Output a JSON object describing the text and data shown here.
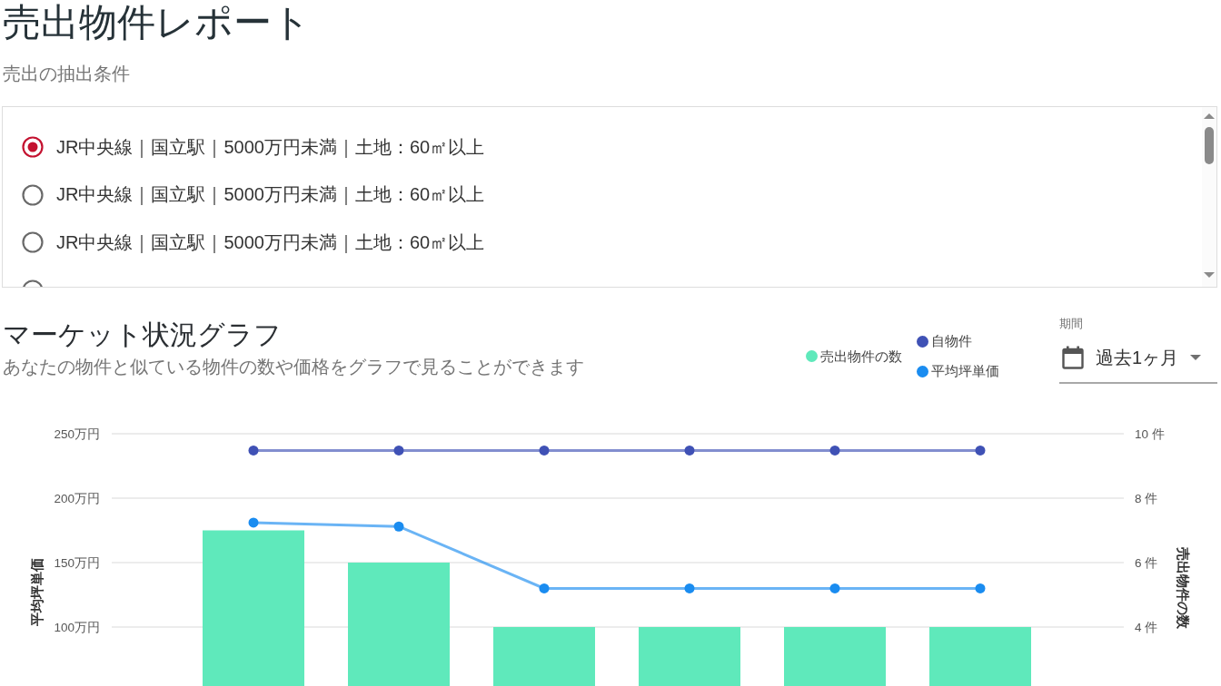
{
  "title": "売出物件レポート",
  "conditions": {
    "heading": "売出の抽出条件",
    "options": [
      {
        "label": "JR中央線｜国立駅｜5000万円未満｜土地：60㎡以上",
        "selected": true
      },
      {
        "label": "JR中央線｜国立駅｜5000万円未満｜土地：60㎡以上",
        "selected": false
      },
      {
        "label": "JR中央線｜国立駅｜5000万円未満｜土地：60㎡以上",
        "selected": false
      },
      {
        "selected": false
      }
    ]
  },
  "market": {
    "title": "マーケット状況グラフ",
    "description": "あなたの物件と似ている物件の数や価格をグラフで見ることができます",
    "period": {
      "label": "期間",
      "value": "過去1ヶ月"
    },
    "chart_data": {
      "type": "bar",
      "ylabel": "平均坪単価",
      "y2label": "売出物件の数",
      "ylim": [
        0,
        250
      ],
      "y2lim": [
        0,
        10
      ],
      "grid": true,
      "legend": "top-right",
      "yticks": [
        {
          "value": 250,
          "label": "250万円"
        },
        {
          "value": 200,
          "label": "200万円"
        },
        {
          "value": 150,
          "label": "150万円"
        },
        {
          "value": 100,
          "label": "100万円"
        }
      ],
      "y2ticks": [
        {
          "value": 10,
          "label": "10 件"
        },
        {
          "value": 8,
          "label": "8 件"
        },
        {
          "value": 6,
          "label": "6 件"
        },
        {
          "value": 4,
          "label": "4 件"
        }
      ],
      "series": [
        {
          "name": "売出物件の数",
          "axis": "y2",
          "color": "#5fe9bb",
          "values": [
            7,
            6,
            4,
            4,
            4,
            4
          ]
        },
        {
          "name": "自物件",
          "type": "line",
          "marker": "circle",
          "color": "#3f51b5",
          "values": [
            237,
            237,
            237,
            237,
            237,
            237
          ]
        },
        {
          "name": "平均坪単価",
          "type": "line",
          "marker": "circle",
          "color": "#1a8cf0",
          "values": [
            181,
            178,
            130,
            130,
            130,
            130
          ]
        }
      ]
    }
  }
}
